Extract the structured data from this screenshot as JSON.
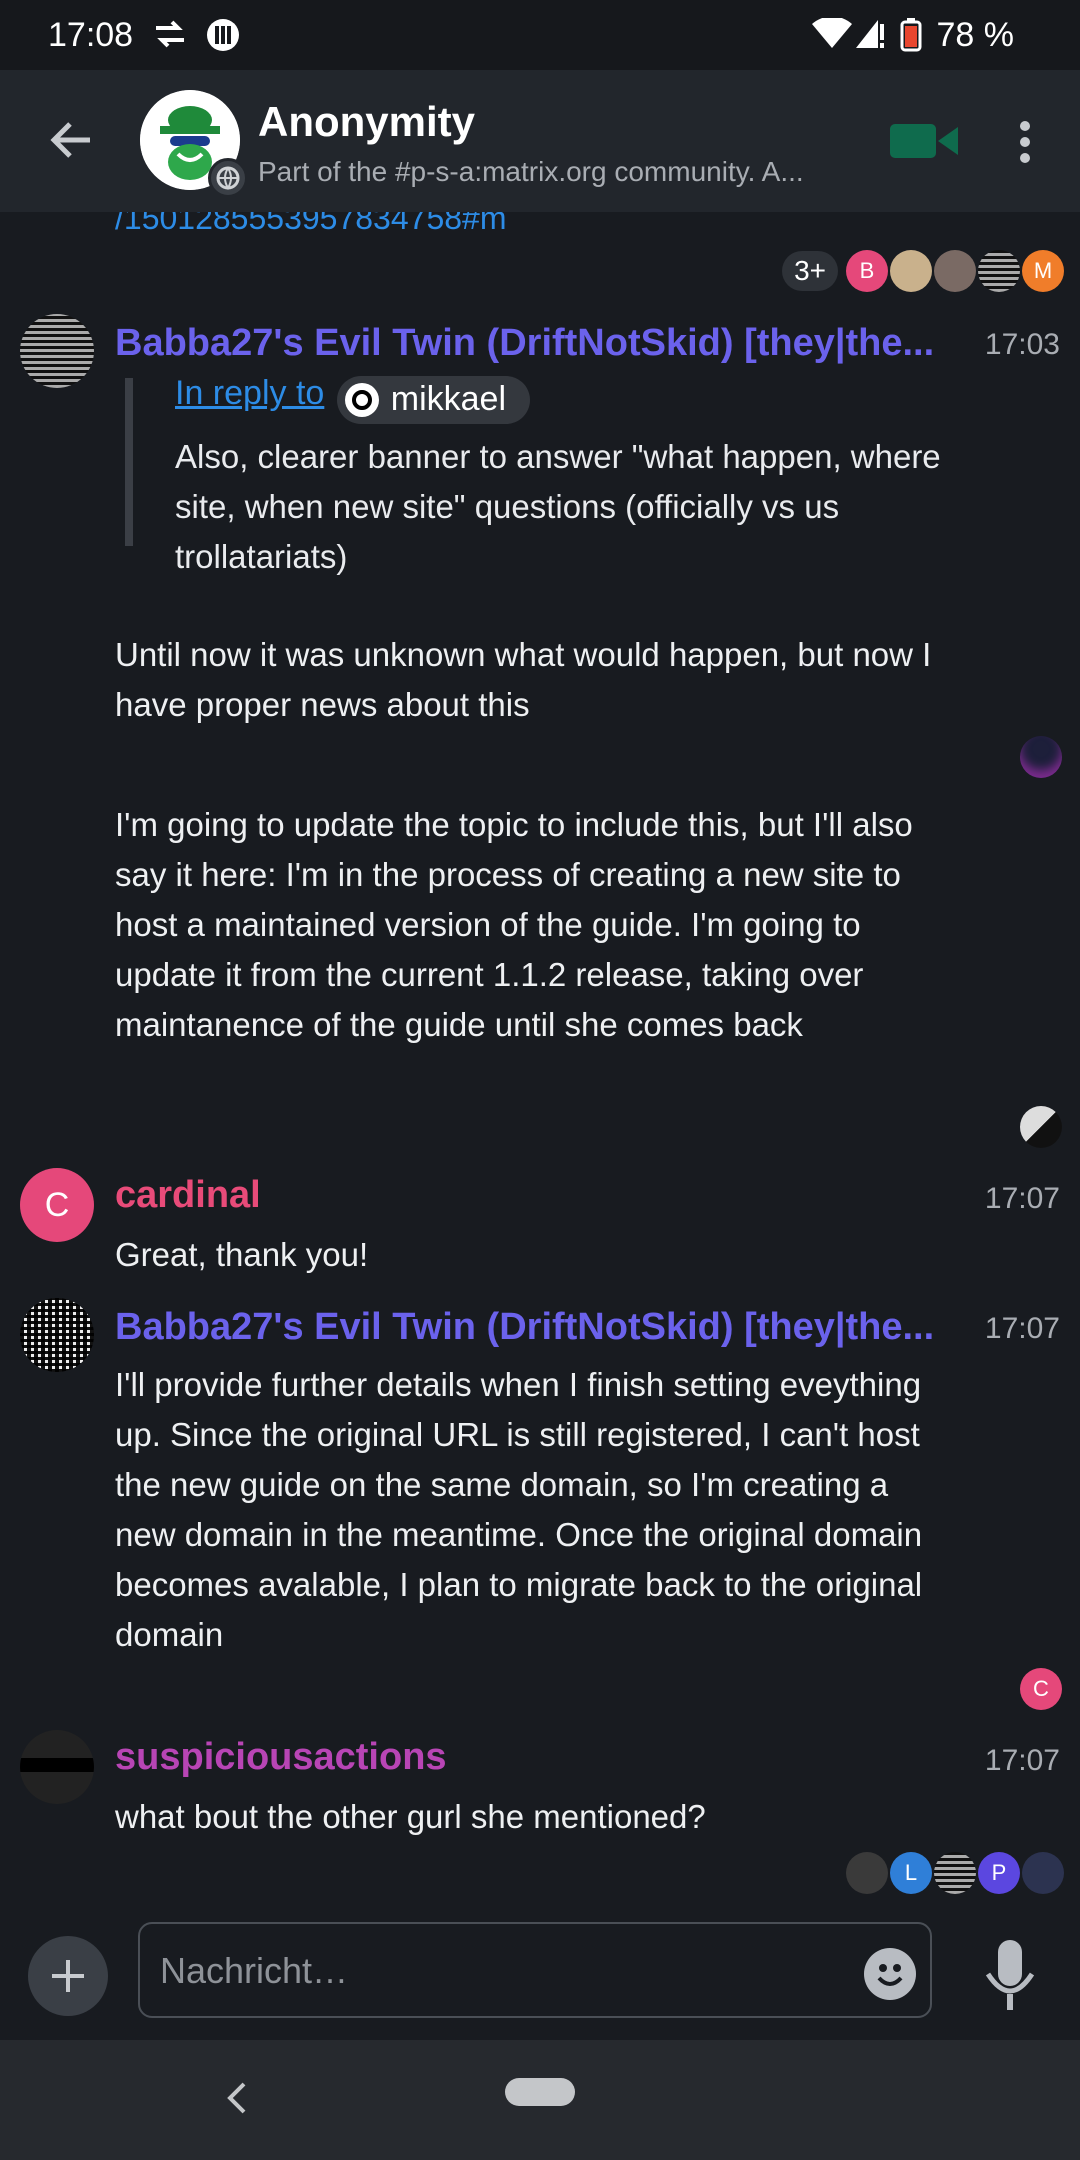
{
  "status_bar": {
    "time": "17:08",
    "battery": "78 %"
  },
  "header": {
    "title": "Anonymity",
    "subtitle": "Part of the #p-s-a:matrix.org community. A..."
  },
  "timeline": {
    "link_tail": "/1501285553957834758#m",
    "top_read_receipts_count": "3+",
    "messages": [
      {
        "sender": "Babba27's Evil Twin (DriftNotSkid) [they|the...",
        "time": "17:03",
        "reply_label": "In reply to",
        "reply_user": "mikkael",
        "reply_text": "Also, clearer banner to answer \"what happen, where site, when new site\" questions (officially vs us trollatariats)",
        "paragraph1": "Until now it was unknown what would happen, but now I have proper news about this",
        "paragraph2": "I'm going to update the topic to include this, but I'll also say it here: I'm in the process of creating a new site to host a maintained version of the guide. I'm going to update it from the current 1.1.2 release, taking over maintanence of the guide until she comes back"
      },
      {
        "sender": "cardinal",
        "avatar_letter": "C",
        "time": "17:07",
        "text": "Great, thank you!"
      },
      {
        "sender": "Babba27's Evil Twin (DriftNotSkid) [they|the...",
        "time": "17:07",
        "text": "I'll provide further details when I finish setting eveything up. Since the original URL is still registered, I can't host the new guide on the same domain, so I'm creating a new domain in the meantime. Once the original domain becomes avalable, I plan to migrate back to the original domain"
      },
      {
        "sender": "suspiciousactions",
        "time": "17:07",
        "text": "what bout the other gurl she mentioned?"
      }
    ],
    "receipt_letters": {
      "b": "B",
      "m": "M",
      "c": "C",
      "l": "L",
      "p": "P"
    }
  },
  "composer": {
    "placeholder": "Nachricht…"
  },
  "colors": {
    "background": "#181b20",
    "accent_green": "#0f6b4d",
    "link": "#2d8ce6",
    "sender_blue": "#6b62ec",
    "sender_pink": "#e84b79",
    "sender_purple": "#b845b5"
  }
}
